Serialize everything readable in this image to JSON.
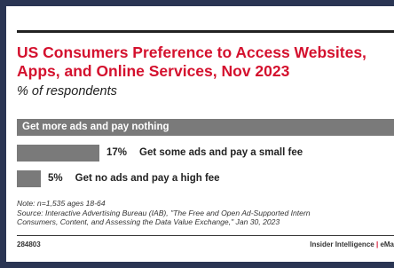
{
  "header": {
    "title_line1": "US Consumers Preference to Access Websites,",
    "title_line2": "Apps, and Online Services, Nov 2023",
    "subtitle": "% of respondents"
  },
  "chart_data": {
    "type": "bar",
    "orientation": "horizontal",
    "categories": [
      "Get more ads and pay nothing",
      "Get some ads and pay a small fee",
      "Get no ads and pay a high fee"
    ],
    "series": [
      {
        "values": [
          78,
          17,
          5
        ]
      }
    ],
    "value_labels": [
      "",
      "17%",
      "5%"
    ],
    "xlim": [
      0,
      78
    ],
    "grid": false,
    "colors": {
      "bar": "#7a7a7a",
      "title": "#d4112e"
    }
  },
  "footer": {
    "note": "Note: n=1,535 ages 18-64",
    "source_line1": "Source: Interactive Advertising Bureau (IAB), \"The Free and Open Ad-Supported Intern",
    "source_line2": "Consumers, Content, and Assessing the Data Value Exchange,\" Jan 30, 2023",
    "chart_id": "284803",
    "brand": "Insider Intelligence",
    "brand_sep": "|",
    "brand_tail": "eMa"
  }
}
